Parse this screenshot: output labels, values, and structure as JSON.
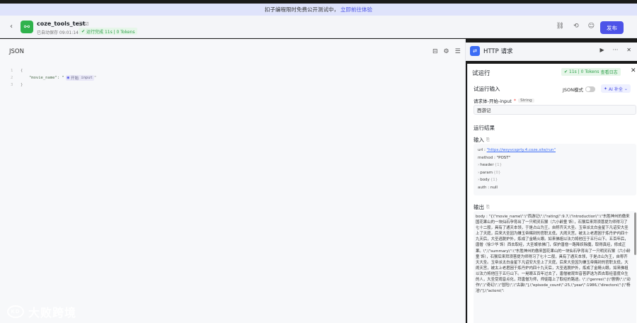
{
  "banner": {
    "text": "扣子编程限时免费公开测试中，",
    "link": "立即前往体验"
  },
  "topbar": {
    "back_icon": "back-arrow-icon",
    "app_name": "coze_tools_test",
    "title_icons": "ⓘ ☑",
    "save_status": "已自动保存 09:01:14",
    "run_status": "运行完成 11s | 0 Tokens",
    "publish_label": "发布"
  },
  "json_panel": {
    "title": "JSON",
    "lines": [
      {
        "no": "1",
        "text": "{"
      },
      {
        "no": "2",
        "key": "\"movie_name\": \"",
        "tag_label": "开始",
        "tag_value": "input",
        "suffix": "\""
      },
      {
        "no": "3",
        "text": "}"
      }
    ]
  },
  "http_node": {
    "title": "HTTP 请求"
  },
  "trial": {
    "title": "试运行",
    "status": "11s | 0 Tokens",
    "log_link": "查看日志",
    "input_title": "试运行输入",
    "json_mode_label": "JSON模式",
    "ai_label": "AI 补全",
    "field_label": "请求体-开始-input",
    "field_type": "String",
    "field_value": "西游记",
    "result_title": "运行结果",
    "input_section": "输入",
    "input_rows": [
      {
        "key": "url",
        "value": "\"https://wsyvcsprty.4.coze.site/run\""
      },
      {
        "key": "method",
        "value": "\"POST\""
      },
      {
        "key": "header",
        "count": "{1}"
      },
      {
        "key": "param",
        "count": "{0}"
      },
      {
        "key": "body",
        "count": "{1}"
      },
      {
        "key": "auth",
        "value": "null"
      }
    ],
    "output_section": "输出",
    "output_text": "body : \"{\\\"movie_name\\\":\\\"西游记\\\",\\\"rating\\\":9.7,\\\"introduction\\\":\\\"东胜神州的傲来国花果山的一块仙石孕育出了一只明灵石猴（六小龄童 饰），石猴后来拜须菩提为师得习了七十二般，具有了通天本领，于是占山为王，自称齐天大圣。玉帝派太白金星下凡诏安大圣上了天庭，后来大圣因为嫌玉帝赐封的官职太低，大闹天宫，被太上老君困于炼丹炉内四十九天后，大圣逃脱炉外，炼成了金睛火眼。如来佛祖以法力将他压于五行山下。五百年后，唐僧（徐少华 饰）西去取经，大圣皈依佛门，保护唐僧一路降妖除魔，取得真经，修成正果。\\\",\\\"summary\\\":\\\"东胜神州的傲来国花果山的一块仙石孕育出了一只明灵石猴（六小龄童 饰），石猴后来拜须菩提为师得习了七十二般，具有了通天本领，于是占山为王，自称齐天大圣。玉帝派太白金星下凡诏安大圣上了天庭，后来大圣因为嫌玉帝赐封的官职太低，大闹天宫，被太上老君困于炼丹炉内四十九天后，大圣逃脱炉外，炼成了金睛火眼。如来佛祖以法力将他压于五行山下。一晃眼五百年过去了，唐僧被观世音菩萨选为西去取经普度众生的人，大圣受观音点化，拜唐僧为师，师徒踏上了取经的路途。\\\",\\\"genres\\\":[\\\"剧情\\\",\\\"动作\\\",\\\"奇幻\\\",\\\"冒险\\\",\\\"古装\\\"],\\\"episode_count\\\":25,\\\"year\\\":1986,\\\"directors\\\":[\\\"杨洁\\\"],\\\"actors\\\":"
  },
  "watermark": {
    "logo": "KD",
    "text": "大败跨境"
  },
  "colors": {
    "accent": "#4d53e8",
    "success": "#2fa04a",
    "http_icon": "#3b6cf5"
  }
}
